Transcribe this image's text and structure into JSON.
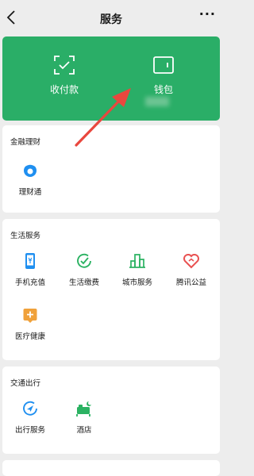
{
  "nav": {
    "title": "服务",
    "more": "···"
  },
  "hero": {
    "pay_label": "收付款",
    "wallet_label": "钱包"
  },
  "sections": {
    "finance": {
      "title": "金融理财",
      "items": [
        {
          "label": "理财通"
        }
      ]
    },
    "life": {
      "title": "生活服务",
      "items": [
        {
          "label": "手机充值"
        },
        {
          "label": "生活缴费"
        },
        {
          "label": "城市服务"
        },
        {
          "label": "腾讯公益"
        },
        {
          "label": "医疗健康"
        }
      ]
    },
    "travel": {
      "title": "交通出行",
      "items": [
        {
          "label": "出行服务"
        },
        {
          "label": "酒店"
        }
      ]
    }
  },
  "colors": {
    "brand_green": "#2aae67",
    "annotation_arrow": "#e9473e",
    "icon_blue": "#1f8ff0",
    "icon_green": "#2bb262",
    "icon_red": "#e95151",
    "icon_orange": "#f0a13a"
  }
}
